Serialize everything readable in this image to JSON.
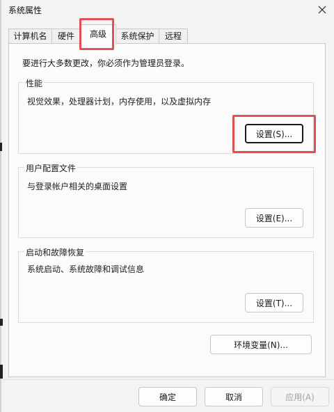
{
  "window": {
    "title": "系统属性",
    "close_icon": "close-icon"
  },
  "tabs": [
    {
      "label": "计算机名",
      "active": false
    },
    {
      "label": "硬件",
      "active": false
    },
    {
      "label": "高级",
      "active": true
    },
    {
      "label": "系统保护",
      "active": false
    },
    {
      "label": "远程",
      "active": false
    }
  ],
  "note": "要进行大多数更改，你必须作为管理员登录。",
  "performance": {
    "title": "性能",
    "description": "视觉效果，处理器计划，内存使用，以及虚拟内存",
    "button": "设置(S)..."
  },
  "user_profiles": {
    "title": "用户配置文件",
    "description": "与登录帐户相关的桌面设置",
    "button": "设置(E)..."
  },
  "startup": {
    "title": "启动和故障恢复",
    "description": "系统启动、系统故障和调试信息",
    "button": "设置(T)..."
  },
  "env_button": "环境变量(N)...",
  "footer": {
    "ok": "确定",
    "cancel": "取消",
    "apply": "应用(A)"
  },
  "colors": {
    "highlight": "#e05252",
    "panel": "#fbfbfb",
    "window": "#f3f3f3"
  }
}
